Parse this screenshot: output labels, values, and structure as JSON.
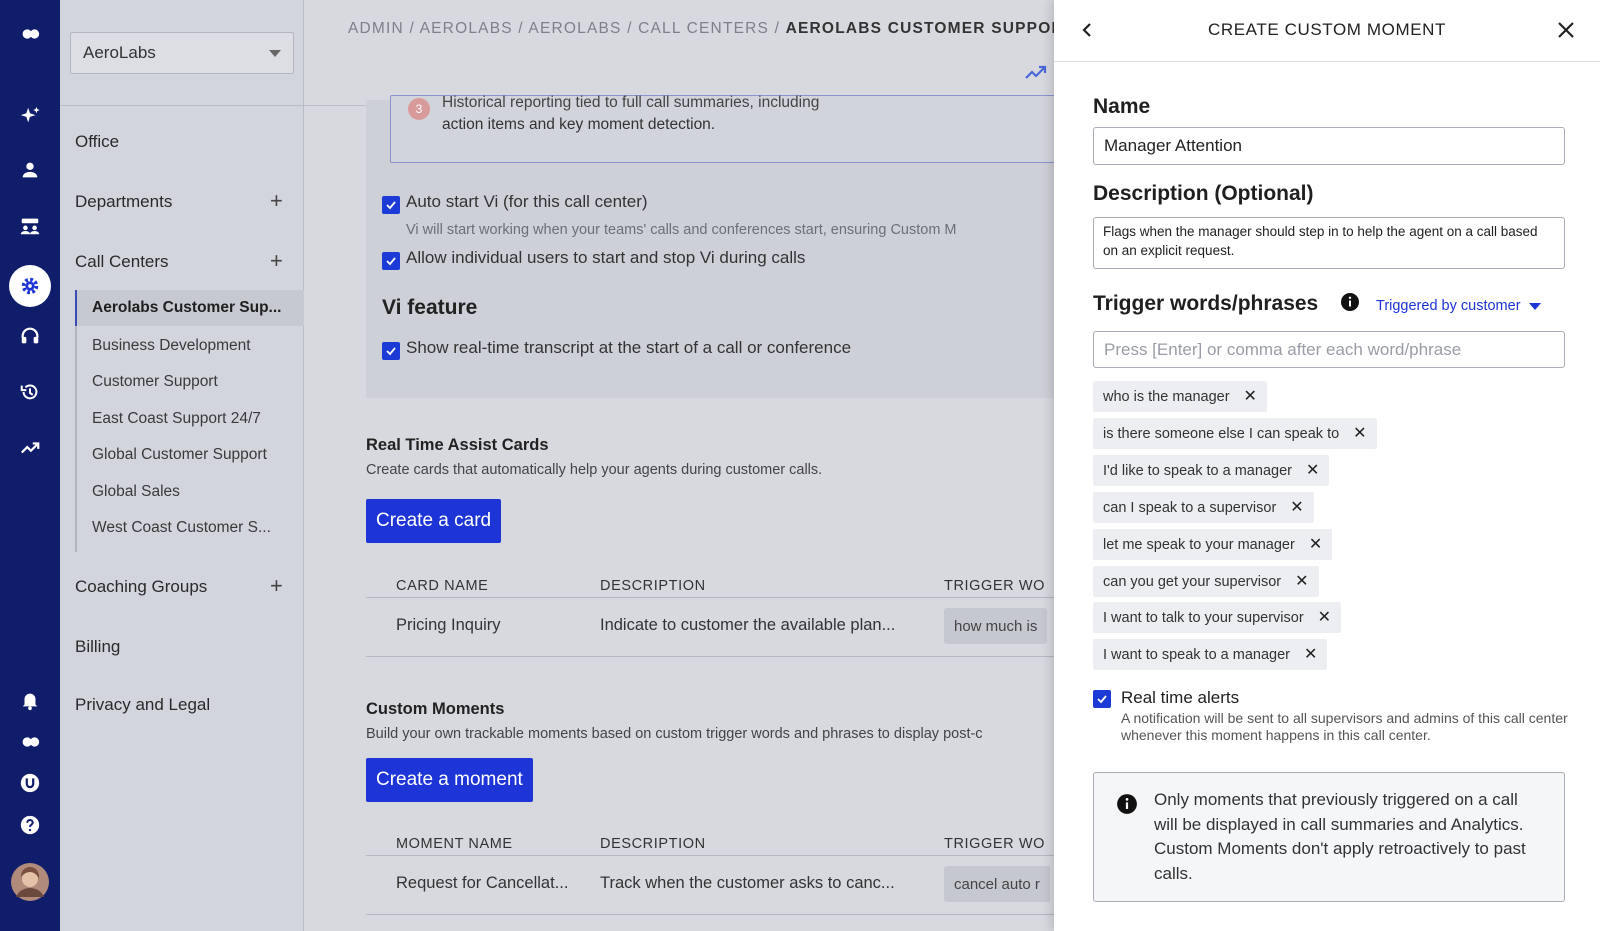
{
  "org_selector": {
    "value": "AeroLabs"
  },
  "rail": {
    "icons": [
      "logo-icon",
      "sparkle-icon",
      "user-icon",
      "team-icon",
      "gear-icon",
      "headset-icon",
      "history-icon",
      "trend-icon",
      "bell-icon",
      "brand-icon",
      "u-icon",
      "help-icon",
      "avatar"
    ]
  },
  "sidebar": {
    "office": "Office",
    "departments": "Departments",
    "call_centers": "Call Centers",
    "call_center_items": [
      "Aerolabs Customer Sup...",
      "Business Development",
      "Customer Support",
      "East Coast Support 24/7",
      "Global Customer Support",
      "Global Sales",
      "West Coast Customer S..."
    ],
    "coaching_groups": "Coaching Groups",
    "billing": "Billing",
    "privacy": "Privacy and Legal"
  },
  "breadcrumb": {
    "path": "ADMIN / AEROLABS / AEROLABS / CALL CENTERS / ",
    "current": "AEROLABS CUSTOMER SUPPOR"
  },
  "main": {
    "historical_line1": "Historical reporting tied to full call summaries, including",
    "historical_line2": "action items and key moment detection.",
    "badge": "3",
    "auto_start": "Auto start Vi (for this call center)",
    "auto_start_desc": "Vi will start working when your teams' calls and conferences start, ensuring Custom M",
    "allow_users": "Allow individual users to start and stop Vi during calls",
    "vi_feature": "Vi feature",
    "show_transcript": "Show real-time transcript at the start of a call or conference",
    "rta_title": "Real Time Assist Cards",
    "rta_desc": "Create cards that automatically help your agents during customer calls.",
    "create_card": "Create a card",
    "cards_table": {
      "headers": [
        "CARD NAME",
        "DESCRIPTION",
        "TRIGGER WO"
      ],
      "row": [
        "Pricing Inquiry",
        "Indicate to customer the available plan...",
        "how much is"
      ]
    },
    "cm_title": "Custom Moments",
    "cm_desc": "Build your own trackable moments based on custom trigger words and phrases to display post-c",
    "create_moment": "Create a moment",
    "moments_table": {
      "headers": [
        "MOMENT NAME",
        "DESCRIPTION",
        "TRIGGER WO"
      ],
      "row": [
        "Request for Cancellat...",
        "Track when the customer asks to canc...",
        "cancel auto r"
      ]
    }
  },
  "panel": {
    "title": "CREATE CUSTOM MOMENT",
    "name_label": "Name",
    "name_value": "Manager Attention",
    "desc_label": "Description (Optional)",
    "desc_value": "Flags when the manager should step in to help the agent on a call based on an explicit request.",
    "trigger_label": "Trigger words/phrases",
    "trigger_selector": "Triggered by customer",
    "trigger_placeholder": "Press [Enter] or comma after each word/phrase",
    "tags": [
      "who is the manager",
      "is there someone else I can speak to",
      "I'd like to speak to a manager",
      "can I speak to a supervisor",
      "let me speak to your manager",
      "can you get your supervisor",
      "I want to talk to your supervisor",
      "I want to speak to a manager"
    ],
    "realtime_label": "Real time alerts",
    "realtime_desc": "A notification will be sent to all supervisors and admins of this call center whenever this moment happens in this call center.",
    "notice": "Only moments that previously triggered on a call will be displayed in call summaries and Analytics. Custom Moments don't apply retroactively to past calls."
  },
  "colors": {
    "rail": "#0f1d6b",
    "accent": "#1d35d6"
  }
}
